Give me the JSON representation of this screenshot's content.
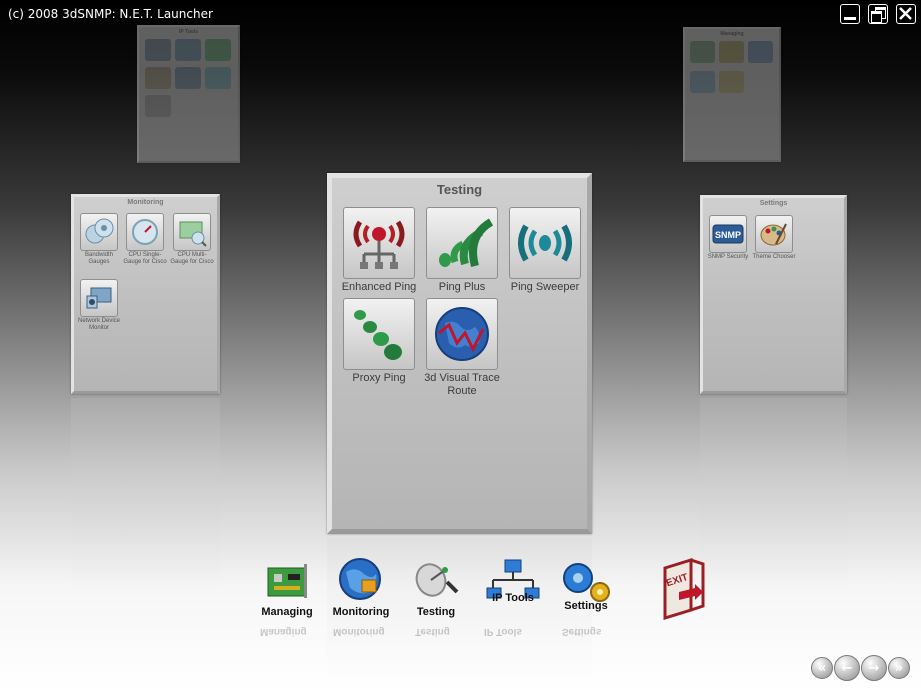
{
  "window": {
    "title": "(c) 2008 3dSNMP: N.E.T. Launcher",
    "minimize_icon": "minimize-icon",
    "restore_icon": "restore-icon",
    "close_icon": "close-icon"
  },
  "testing": {
    "title": "Testing",
    "tiles": [
      {
        "label": "Enhanced Ping",
        "icon": "enhanced-ping-icon"
      },
      {
        "label": "Ping Plus",
        "icon": "ping-plus-icon"
      },
      {
        "label": "Ping Sweeper",
        "icon": "ping-sweeper-icon"
      },
      {
        "label": "Proxy Ping",
        "icon": "proxy-ping-icon"
      },
      {
        "label": "3d Visual Trace Route",
        "icon": "trace-route-globe-icon"
      }
    ]
  },
  "monitoring": {
    "title": "Monitoring",
    "tiles": [
      {
        "label": "Bandwidth Gauges",
        "icon": "bandwidth-gauge-icon"
      },
      {
        "label": "CPU Single-Gauge for Cisco",
        "icon": "cpu-single-gauge-icon"
      },
      {
        "label": "CPU Multi-Gauge for Cisco",
        "icon": "cpu-multi-gauge-icon"
      },
      {
        "label": "Network Device Monitor",
        "icon": "network-device-monitor-icon"
      }
    ]
  },
  "settings": {
    "title": "Settings",
    "tiles": [
      {
        "label": "SNMP Security",
        "icon": "snmp-security-icon"
      },
      {
        "label": "Theme Chooser",
        "icon": "theme-chooser-icon"
      }
    ]
  },
  "ip_tools_back": {
    "title": "IP Tools"
  },
  "managing_back": {
    "title": "Managing"
  },
  "dock": {
    "items": [
      {
        "label": "Managing",
        "icon": "managing-circuit-board-icon"
      },
      {
        "label": "Monitoring",
        "icon": "monitoring-globe-icon"
      },
      {
        "label": "Testing",
        "icon": "testing-satellite-dish-icon"
      },
      {
        "label": "IP Tools",
        "icon": "ip-tools-network-icon"
      },
      {
        "label": "Settings",
        "icon": "settings-gears-icon"
      }
    ],
    "exit_label": "EXIT",
    "exit_icon": "exit-door-icon"
  },
  "nav": {
    "first_icon": "double-left-arrow-icon",
    "prev_icon": "left-arrow-icon",
    "next_icon": "right-arrow-icon",
    "last_icon": "double-right-arrow-icon"
  },
  "colors": {
    "panel": "#c4c4c4",
    "trace_red": "#c0152a",
    "ping_green": "#2f9a4a",
    "ping_teal": "#1d8a9a"
  }
}
